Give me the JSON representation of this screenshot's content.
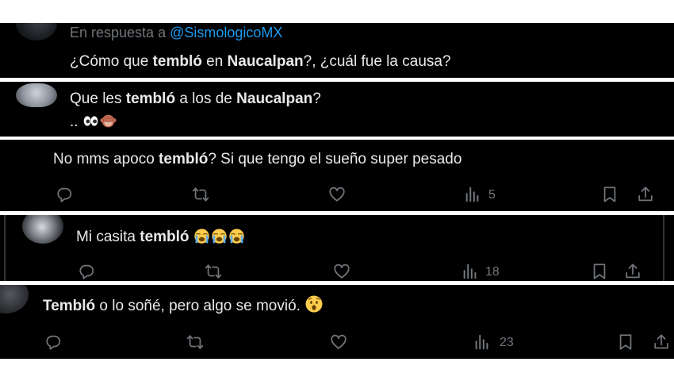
{
  "colors": {
    "background": "#000000",
    "text": "#e7e9ea",
    "muted": "#71767b",
    "mention": "#1d9bf0"
  },
  "reply1": {
    "reply_prefix": "En respuesta a",
    "mention": "@SismologicoMX",
    "t1": "¿Cómo que ",
    "b1": "tembló",
    "t2": " en ",
    "b2": "Naucalpan",
    "t3": "?, ¿cuál fue la causa?"
  },
  "reply2": {
    "t1": "Que les ",
    "b1": "tembló",
    "t2": " a los de ",
    "b2": "Naucalpan",
    "t3": "?",
    "line2": "..",
    "emojis": [
      "eyes-emoji",
      "see-no-evil-monkey-emoji"
    ]
  },
  "reply3": {
    "t1": "No mms apoco ",
    "b1": "tembló",
    "t2": "? Si que tengo el sueño super pesado",
    "views": "5"
  },
  "reply4": {
    "t1": "Mi casita ",
    "b1": "tembló",
    "emojis": [
      "loudly-crying-face-emoji",
      "loudly-crying-face-emoji",
      "loudly-crying-face-emoji"
    ],
    "views": "18"
  },
  "reply5": {
    "b1": "Tembló",
    "t1": " o lo soñé, pero algo se movió. ",
    "emoji": "astonished-face-emoji",
    "views": "23"
  }
}
